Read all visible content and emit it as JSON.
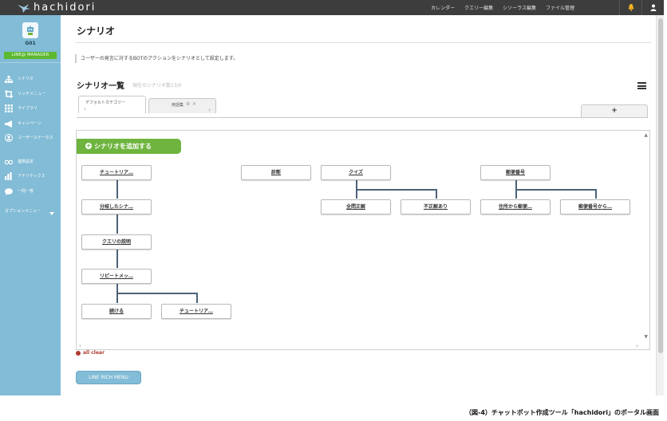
{
  "app": {
    "brand": "hachidori"
  },
  "topnav": [
    "カレンダー",
    "クエリー編集",
    "シソーラス編集",
    "ファイル管理"
  ],
  "sidebar": {
    "name": "G01",
    "badge": "LINE@ MANAGER",
    "items": [
      {
        "label": "シナリオ",
        "icon": "sitemap-icon"
      },
      {
        "label": "リッチメニュー",
        "icon": "crop-icon"
      },
      {
        "label": "ライブラリ",
        "icon": "grid-icon"
      },
      {
        "label": "キャンペーン",
        "icon": "megaphone-icon"
      },
      {
        "label": "ユーザーステータス",
        "icon": "user-circle-icon"
      },
      {
        "label": "連携設定",
        "icon": "link-icon"
      },
      {
        "label": "アナリティクス",
        "icon": "bar-chart-icon"
      },
      {
        "label": "一問一答",
        "icon": "speech-bubble-icon"
      },
      {
        "label": "オプションメニュー",
        "icon": "caret-down-icon"
      }
    ]
  },
  "main": {
    "title": "シナリオ",
    "description": "ユーザーの発言に対するBOTのアクションをシナリオとして設定します。",
    "list_title": "シナリオ一覧",
    "list_count": "現在のシナリオ数13/0",
    "tabs": [
      {
        "label": "デフォルトカテゴリー"
      },
      {
        "label": "用語集"
      }
    ],
    "add_tab_label": "+",
    "add_scenario_label": "シナリオを追加する",
    "nodes": [
      "チュートリア…",
      "分岐したシナ…",
      "クエリの説明",
      "リピートメッ…",
      "続ける",
      "チュートリア…",
      "診断",
      "クイズ",
      "全問正解",
      "不正解あり",
      "郵便番号",
      "住所から郵便…",
      "郵便番号から…"
    ],
    "all_clear": "all clear",
    "rich_menu_button": "LINE RICH MENU"
  },
  "caption": "（図-4）チャットボット作成ツール「hachidori」のポータル画面",
  "colors": {
    "topbar": "#3d3d3d",
    "sidebar": "#82bcd6",
    "add_button": "#6eb43f",
    "badge": "#5cb82f",
    "connector": "#4d6278",
    "all_clear": "#b03a2e"
  }
}
